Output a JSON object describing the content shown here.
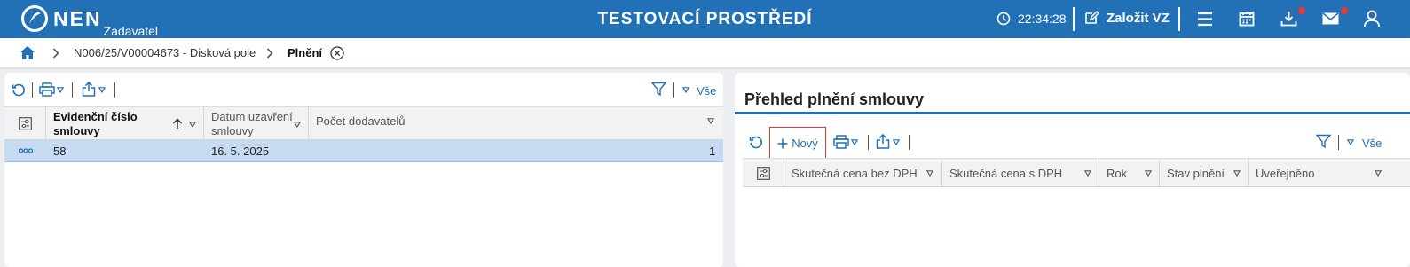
{
  "topbar": {
    "logo_text": "NEN",
    "logo_sub": "Zadavatel",
    "env_title": "TESTOVACÍ PROSTŘEDÍ",
    "clock": "22:34:28",
    "create_label": "Založit VZ",
    "icons": [
      "menu-icon",
      "calendar-icon",
      "download-icon",
      "mail-icon",
      "user-icon"
    ]
  },
  "breadcrumb": {
    "item": "N006/25/V00004673 - Disková pole",
    "current": "Plnění"
  },
  "left": {
    "toolbar": {
      "vse_label": "Vše"
    },
    "columns": [
      {
        "label_line1": "Evidenční číslo",
        "label_line2": "smlouvy"
      },
      {
        "label_line1": "Datum uzavření",
        "label_line2": "smlouvy"
      },
      {
        "label_line1": "Počet dodavatelů",
        "label_line2": ""
      }
    ],
    "rows": [
      {
        "number": "58",
        "date": "16. 5. 2025",
        "suppliers": "1"
      }
    ]
  },
  "right": {
    "title": "Přehled plnění smlouvy",
    "toolbar": {
      "new_label": "Nový",
      "vse_label": "Vše"
    },
    "columns": [
      "Skutečná cena bez DPH",
      "Skutečná cena s DPH",
      "Rok",
      "Stav plnění",
      "Uveřejněno"
    ]
  },
  "colors": {
    "brand": "#2270b5",
    "selected_row": "#c6dbf2",
    "highlight": "#e53935"
  }
}
